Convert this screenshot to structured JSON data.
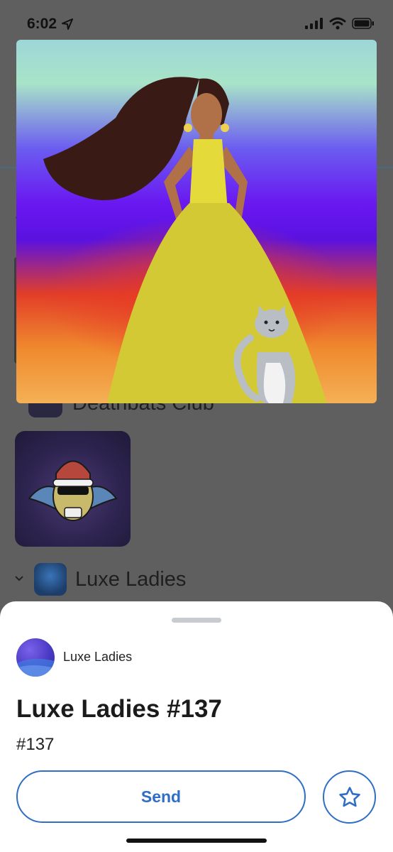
{
  "status_bar": {
    "time": "6:02"
  },
  "background": {
    "collection_1_label": "Deathbats Club",
    "collection_2_label": "Luxe Ladies"
  },
  "sheet": {
    "collection_name": "Luxe Ladies",
    "nft_title": "Luxe Ladies #137",
    "token_id": "#137",
    "send_label": "Send"
  },
  "colors": {
    "accent": "#2f6ec4",
    "overlay": "#5f5f5f",
    "sheet_bg": "#ffffff"
  },
  "icons": [
    "location-arrow-icon",
    "signal-icon",
    "wifi-icon",
    "battery-icon",
    "chevron-down-icon",
    "star-icon"
  ]
}
